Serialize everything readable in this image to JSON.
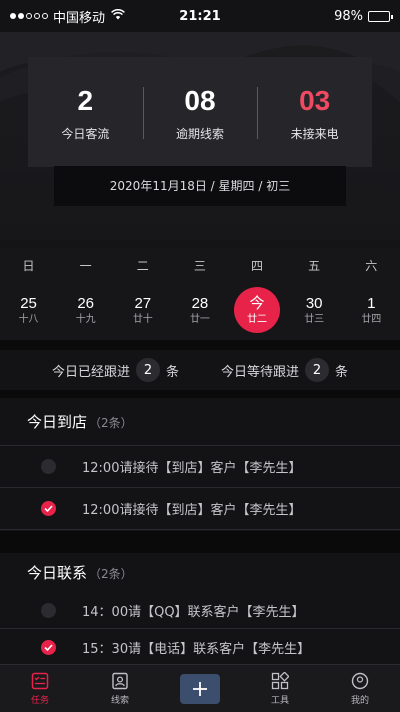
{
  "status_bar": {
    "carrier": "中国移动",
    "time": "21:21",
    "battery": "98%",
    "battery_level": 0.98,
    "signal_bars": 5,
    "signal_filled": 2
  },
  "stats": [
    {
      "value": "2",
      "label": "今日客流",
      "color": "#ffffff"
    },
    {
      "value": "08",
      "label": "逾期线索",
      "color": "#ffffff"
    },
    {
      "value": "03",
      "label": "未接来电",
      "color": "#f04a62"
    }
  ],
  "date_text": "2020年11月18日 / 星期四 / 初三",
  "calendar": {
    "weekdays": [
      "日",
      "一",
      "二",
      "三",
      "四",
      "五",
      "六"
    ],
    "days": [
      {
        "num": "25",
        "lunar": "十八",
        "active": false
      },
      {
        "num": "26",
        "lunar": "十九",
        "active": false
      },
      {
        "num": "27",
        "lunar": "廿十",
        "active": false
      },
      {
        "num": "28",
        "lunar": "廿一",
        "active": false
      },
      {
        "num": "今",
        "lunar": "廿二",
        "active": true
      },
      {
        "num": "30",
        "lunar": "廿三",
        "active": false
      },
      {
        "num": "1",
        "lunar": "廿四",
        "active": false
      }
    ]
  },
  "follow": {
    "done_label": "今日已经跟进",
    "done_count": "2",
    "done_unit": "条",
    "waiting_label": "今日等待跟进",
    "waiting_count": "2",
    "waiting_unit": "条"
  },
  "sections": [
    {
      "title": "今日到店",
      "count": "（2条）",
      "tasks": [
        {
          "text": "12:00请接待【到店】客户【李先生】",
          "done": false
        },
        {
          "text": "12:00请接待【到店】客户【李先生】",
          "done": true
        }
      ]
    },
    {
      "title": "今日联系",
      "count": "（2条）",
      "tasks": [
        {
          "text": "14：00请【QQ】联系客户【李先生】",
          "done": false
        },
        {
          "text": "15：30请【电话】联系客户【李先生】",
          "done": true
        }
      ]
    }
  ],
  "tabbar": [
    {
      "label": "任务",
      "icon": "task-list-icon",
      "active": true
    },
    {
      "label": "线索",
      "icon": "contact-card-icon",
      "active": false
    },
    {
      "label": "",
      "icon": "plus-icon",
      "active": false
    },
    {
      "label": "工具",
      "icon": "tools-grid-icon",
      "active": false
    },
    {
      "label": "我的",
      "icon": "profile-icon",
      "active": false
    }
  ],
  "colors": {
    "accent": "#e8234a",
    "alert": "#f04a62",
    "plus_button": "#3c4e6e"
  }
}
